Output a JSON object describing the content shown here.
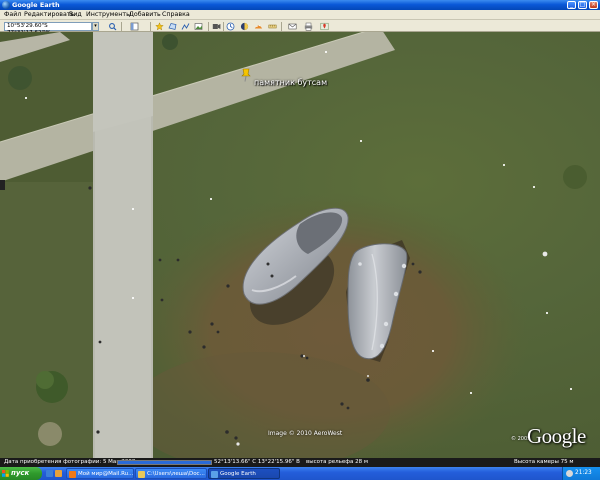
{
  "window": {
    "title": "Google Earth",
    "controls": {
      "minimize": "_",
      "maximize": "□",
      "close": "×"
    }
  },
  "menu": {
    "items": [
      "Файл",
      "Редактировать",
      "Вид",
      "Инструменты",
      "Добавить",
      "Справка"
    ]
  },
  "toolbar": {
    "search_value": "10°53'29.60\"S 77°31'17.62\"W",
    "dropdown_glyph": "▾",
    "buttons": [
      {
        "name": "search-icon"
      },
      {
        "name": "hide-sidebar-icon"
      },
      {
        "name": "placemark-icon"
      },
      {
        "name": "polygon-icon"
      },
      {
        "name": "path-icon"
      },
      {
        "name": "image-overlay-icon"
      },
      {
        "name": "record-tour-icon"
      },
      {
        "name": "historical-imagery-icon"
      },
      {
        "name": "sunlight-icon"
      },
      {
        "name": "switch-sky-icon"
      },
      {
        "name": "ruler-icon"
      },
      {
        "name": "email-icon"
      },
      {
        "name": "print-icon"
      },
      {
        "name": "google-maps-icon"
      }
    ]
  },
  "map": {
    "placemark_label": "памятник бутсам",
    "copyright": "Image © 2010 AeroWest",
    "google_logo": "Google",
    "google_year": "© 2009"
  },
  "status": {
    "date_label": "Дата приобретения фотографии: 5 Мая 2008",
    "stream_progress": 1.0,
    "coords": "52°13'13.66\" С  13°22'15.96\" В",
    "elevation": "высота рельефа    28 м",
    "eye_alt": "Высота камеры      75 м"
  },
  "taskbar": {
    "start_label": "пуск",
    "tasks": [
      {
        "label": "Мой мир@Mail.Ru...",
        "active": false,
        "icon_color": "#f07a1a"
      },
      {
        "label": "C:\\Users\\леша\\Doc...",
        "active": false,
        "icon_color": "#e8c85a"
      },
      {
        "label": "Google Earth",
        "active": true,
        "icon_color": "#5aa0e8"
      }
    ],
    "clock": "21:23"
  },
  "colors": {
    "titlebar": "#0a58d8",
    "grass": "#55663a",
    "path": "#b4b4a4",
    "shoe": "#b6b9bf",
    "placemark": "#f5c400",
    "taskbar": "#245edb",
    "start": "#2f9a2c"
  }
}
